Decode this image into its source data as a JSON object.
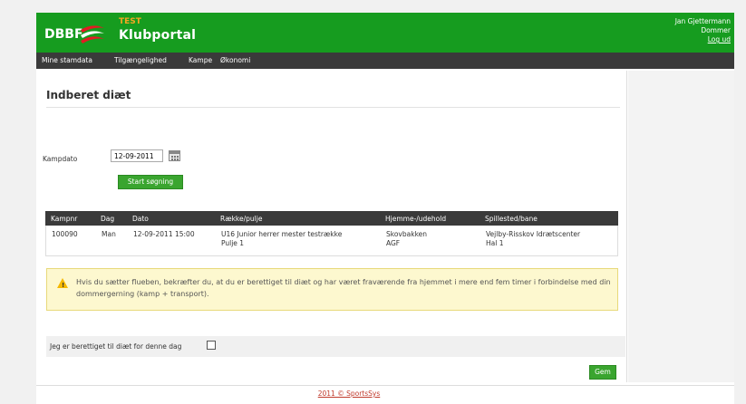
{
  "header": {
    "logo_org": "DBBF",
    "logo_test": "TEST",
    "logo_app": "Klubportal",
    "brand_color": "#169c1f",
    "user_name": "Jan Gjettermann",
    "user_role": "Dommer",
    "logout_label": "Log ud"
  },
  "nav": {
    "items": [
      {
        "label": "Mine stamdata"
      },
      {
        "label": "Tilgængelighed"
      },
      {
        "label": "Kampe"
      },
      {
        "label": "Økonomi"
      }
    ]
  },
  "page": {
    "title": "Indberet diæt"
  },
  "search": {
    "date_label": "Kampdato",
    "date_value": "12-09-2011",
    "calendar_icon": "calendar-icon",
    "button_label": "Start søgning"
  },
  "table": {
    "columns": [
      "Kampnr",
      "Dag",
      "Dato",
      "Række/pulje",
      "Hjemme-/udehold",
      "Spillested/bane"
    ],
    "rows": [
      {
        "kampnr": "100090",
        "dag": "Man",
        "dato": "12-09-2011 15:00",
        "raekke": "U16 Junior herrer mester testrække",
        "pulje": "Pulje 1",
        "hjemme": "Skovbakken",
        "ude": "AGF",
        "spillested": "Vejlby-Risskov Idrætscenter",
        "bane": "Hal 1"
      }
    ]
  },
  "notice": {
    "icon": "warning-icon",
    "text": "Hvis du sætter flueben, bekræfter du, at du er berettiget til diæt og har været fraværende fra hjemmet i mere end fem timer i forbindelse med din dommergerning (kamp + transport)."
  },
  "eligible": {
    "label": "Jeg er berettiget til diæt for denne dag",
    "checked": false
  },
  "actions": {
    "save_label": "Gem"
  },
  "footer": {
    "text": "2011 © SportsSys"
  }
}
